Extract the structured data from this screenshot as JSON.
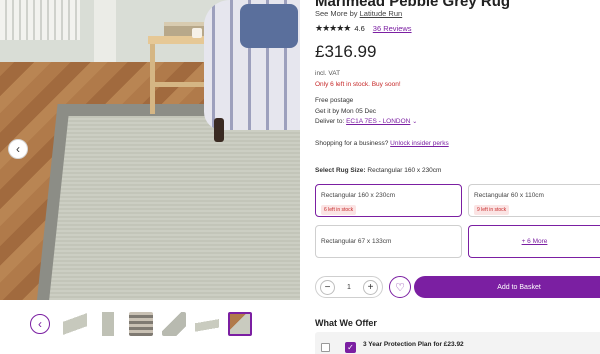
{
  "product": {
    "title": "Marimead Pebble Grey Rug",
    "see_more_prefix": "See More by",
    "brand": "Latitude Run",
    "rating_value": "4.6",
    "rating_stars": 4.5,
    "reviews_label": "36 Reviews",
    "price": "£316.99",
    "vat_note": "incl. VAT",
    "stock_note": "Only 6 left in stock. Buy soon!"
  },
  "shipping": {
    "postage": "Free postage",
    "delivery_estimate": "Get it by Mon 05 Dec",
    "deliver_to_prefix": "Deliver to:",
    "deliver_to_location": "EC1A 7ES - LONDON",
    "business_prefix": "Shopping for a business?",
    "business_link": "Unlock insider perks"
  },
  "size_selector": {
    "label": "Select Rug Size:",
    "selected_value": "Rectangular 160 x 230cm",
    "options": [
      {
        "label": "Rectangular 160 x 230cm",
        "badge": "6 left in stock",
        "selected": true
      },
      {
        "label": "Rectangular 60 x 110cm",
        "badge": "9 left in stock",
        "selected": false
      },
      {
        "label": "Rectangular 67 x 133cm",
        "badge": "",
        "selected": false
      }
    ],
    "more_label": "+ 6 More"
  },
  "purchase": {
    "quantity": "1",
    "minus_symbol": "−",
    "plus_symbol": "+",
    "add_to_basket": "Add to Basket"
  },
  "offers": {
    "title": "What We Offer",
    "protection_plan": "3 Year Protection Plan for £23.92"
  },
  "icons": {
    "prev_image": "chevron-left-icon",
    "wishlist": "heart-icon",
    "location_dropdown": "chevron-down-icon",
    "protection": "shield-icon"
  },
  "colors": {
    "accent": "#7b1fa2",
    "stock_warning": "#c62828"
  }
}
